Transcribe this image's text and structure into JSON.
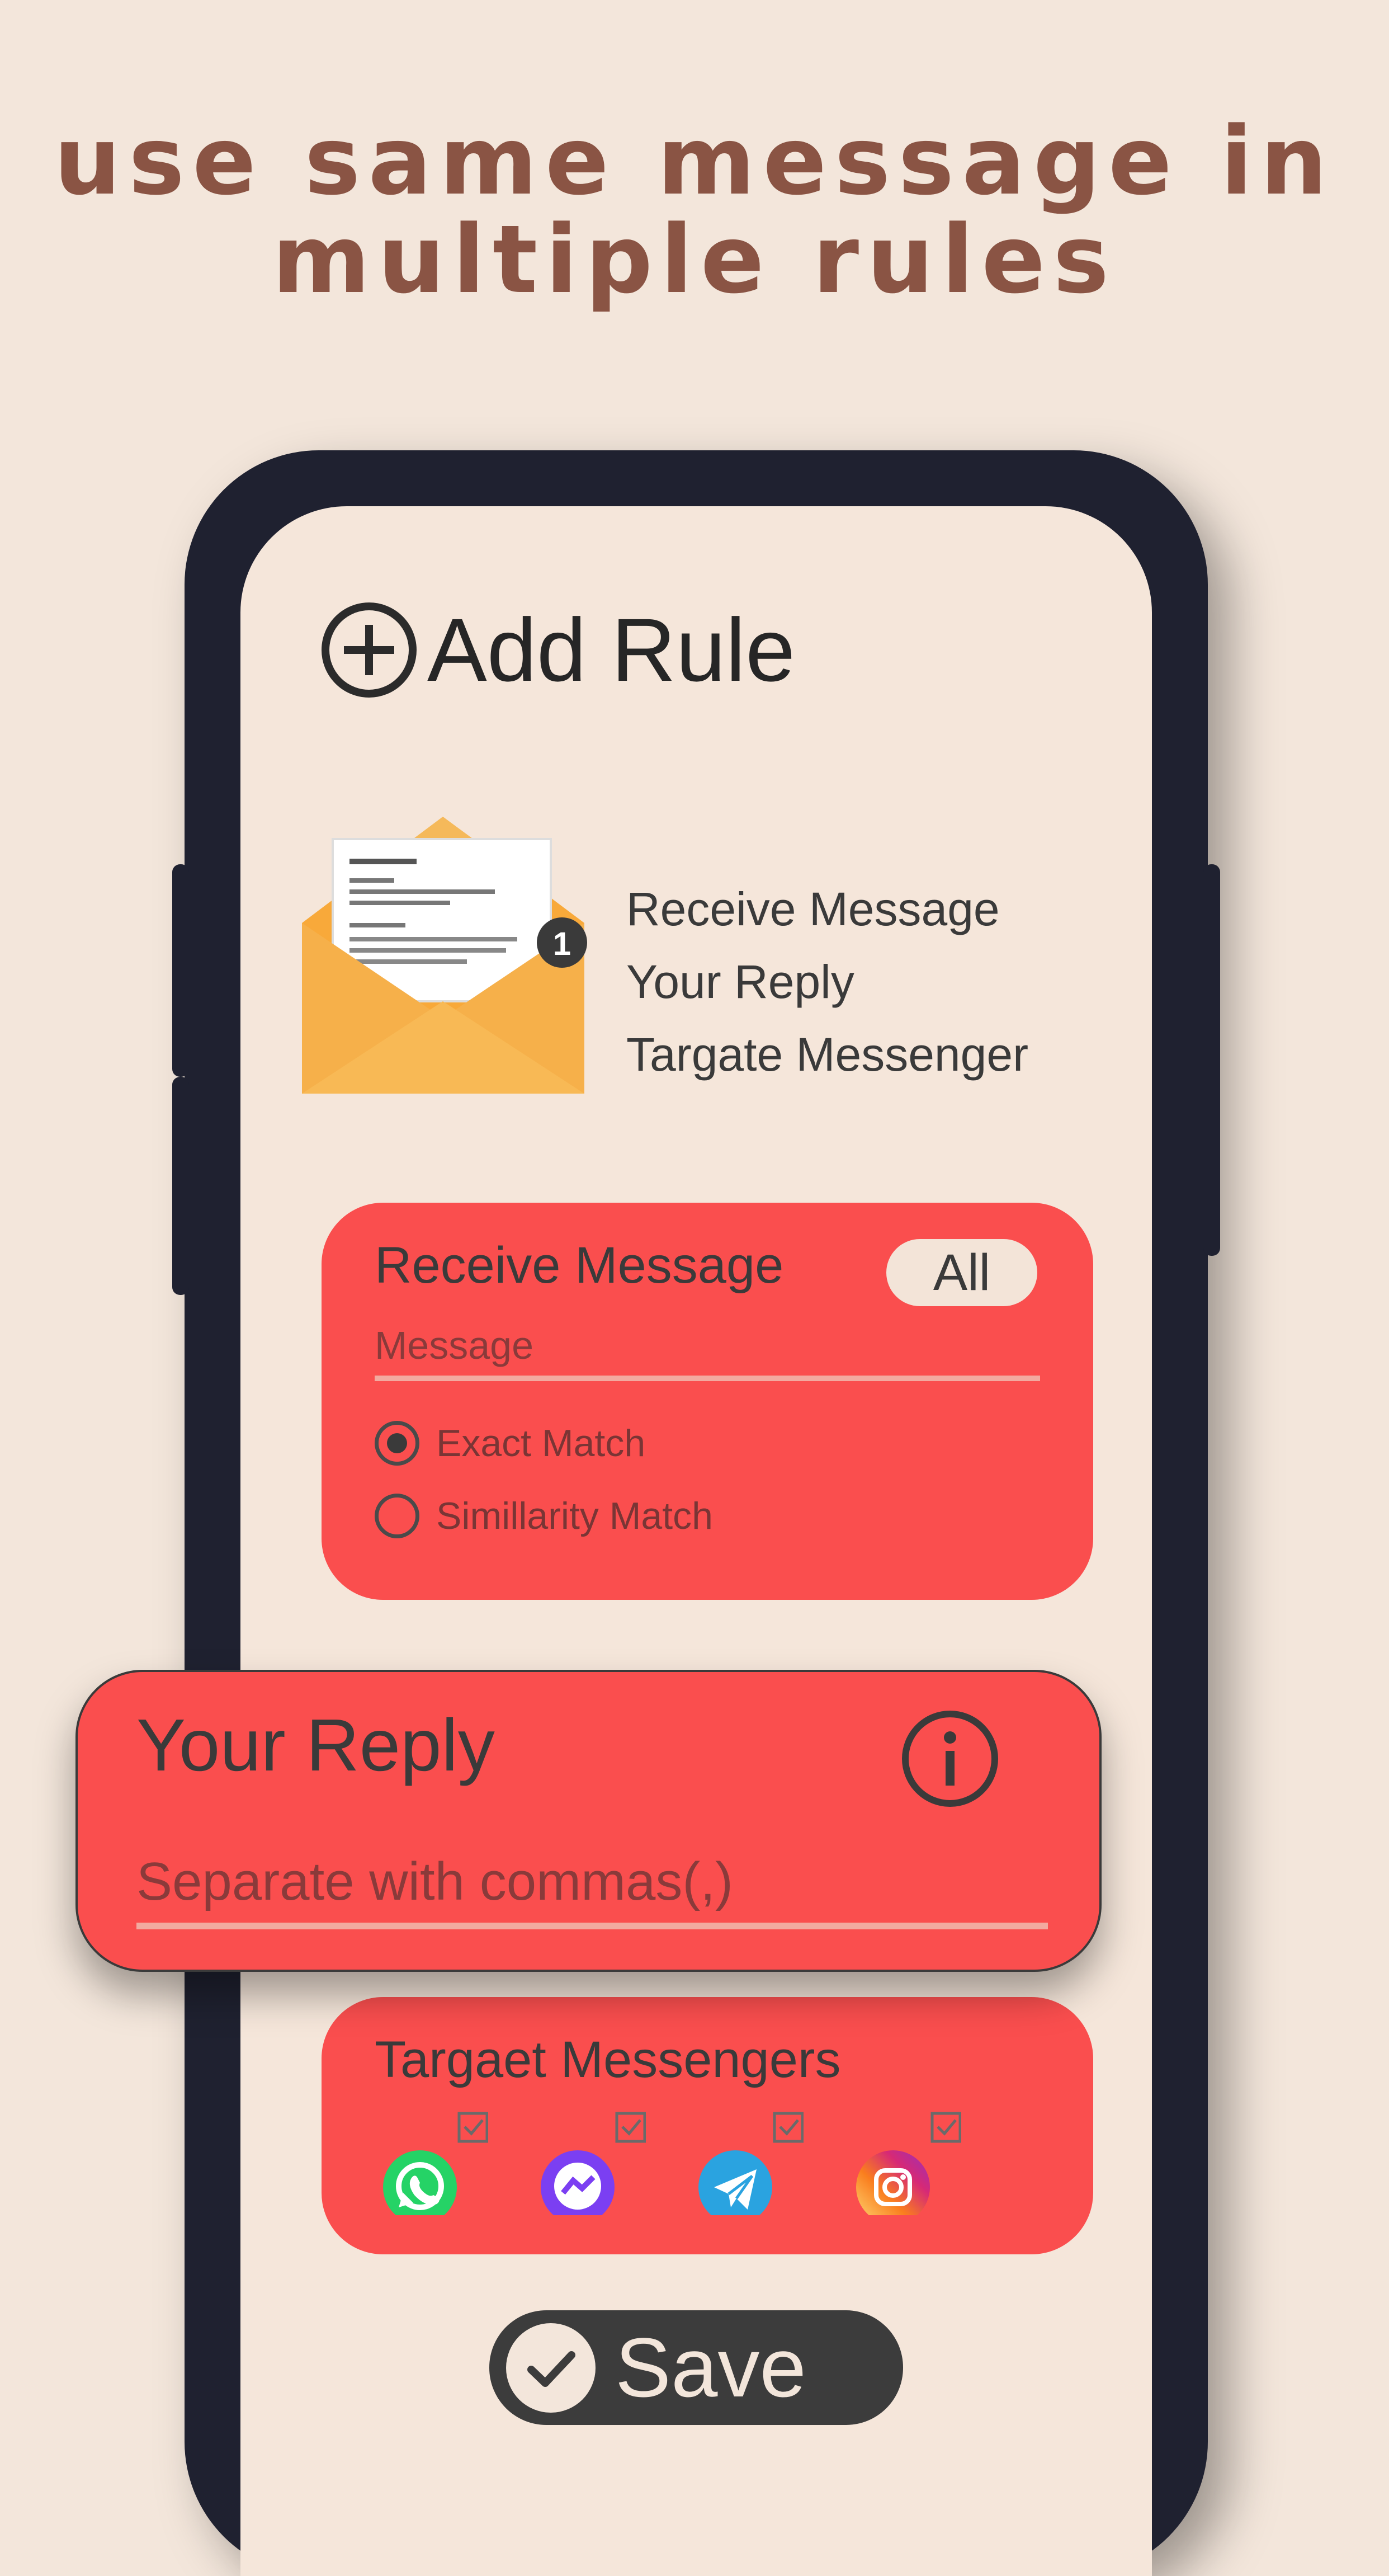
{
  "headline": [
    "use same message in",
    "multiple rules"
  ],
  "screen": {
    "add_rule_title": "Add Rule",
    "illustration": {
      "badge": "1",
      "legend": [
        "Receive Message",
        "Your Reply",
        "Targate Messenger"
      ]
    },
    "receive_card": {
      "title": "Receive Message",
      "all_label": "All",
      "message_placeholder": "Message",
      "options": [
        {
          "label": "Exact Match",
          "selected": true
        },
        {
          "label": "Simillarity Match",
          "selected": false
        }
      ]
    },
    "reply_card": {
      "title": "Your Reply",
      "placeholder": "Separate with commas(,)"
    },
    "targets_card": {
      "title": "Targaet Messengers",
      "messengers": [
        {
          "icon": "whatsapp-icon",
          "color": "#25d366",
          "checked": true
        },
        {
          "icon": "messenger-icon",
          "color": "#7b3ff2",
          "checked": true
        },
        {
          "icon": "telegram-icon",
          "color": "#2aa3e0",
          "checked": true
        },
        {
          "icon": "instagram-icon",
          "color": "#e1306c",
          "checked": true
        }
      ]
    },
    "save_label": "Save"
  },
  "colors": {
    "background": "#f3e6db",
    "headline": "#8a5444",
    "card": "#fa4e4e",
    "phone_frame": "#1f2130",
    "envelope": "#f8a93a"
  }
}
